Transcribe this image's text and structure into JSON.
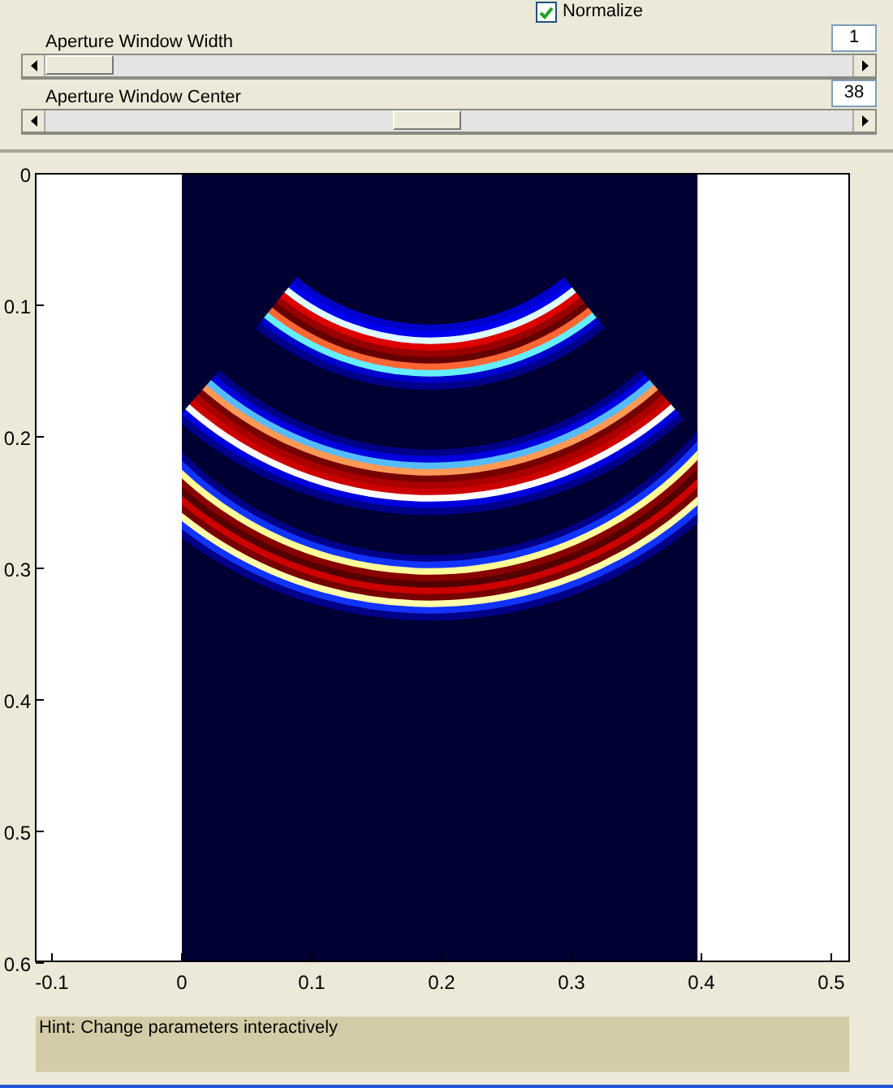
{
  "normalize": {
    "label": "Normalize",
    "checked": true
  },
  "sliders": [
    {
      "label": "Aperture Window Width",
      "value": "1",
      "level": 0.0
    },
    {
      "label": "Aperture Window Center",
      "value": "38",
      "level": 0.47
    }
  ],
  "plot": {
    "xticks": [
      "-0.1",
      "0",
      "0.1",
      "0.2",
      "0.3",
      "0.4",
      "0.5"
    ],
    "yticks": [
      "0",
      "0.1",
      "0.2",
      "0.3",
      "0.4",
      "0.5",
      "0.6"
    ]
  },
  "hint": "Hint: Change parameters interactively"
}
